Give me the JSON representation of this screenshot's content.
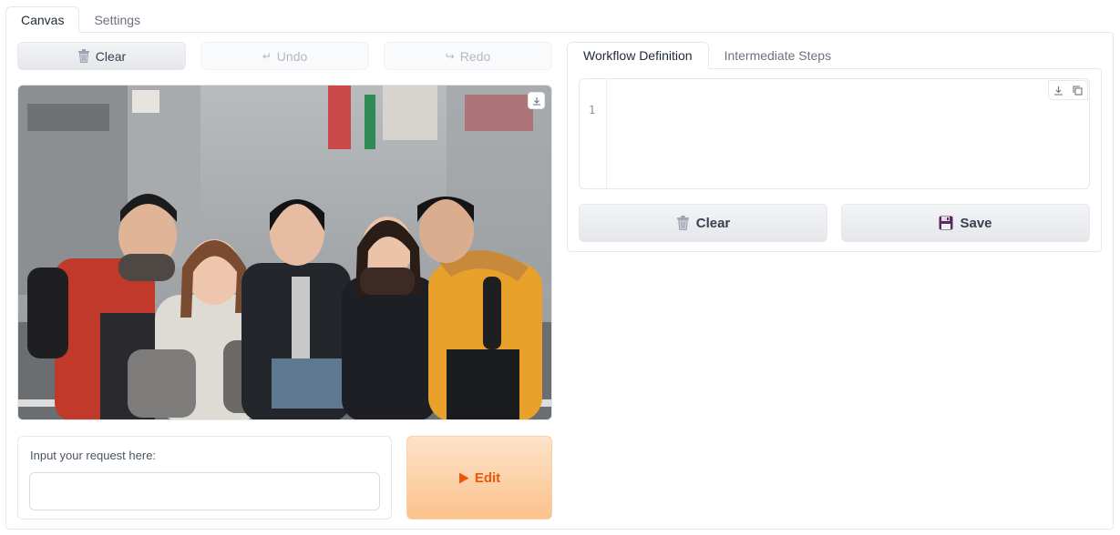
{
  "top_tabs": [
    {
      "label": "Canvas",
      "active": true
    },
    {
      "label": "Settings",
      "active": false
    }
  ],
  "toolbar": {
    "clear_label": "Clear",
    "undo_label": "Undo",
    "redo_label": "Redo"
  },
  "image": {
    "description_icon": "download-icon"
  },
  "request": {
    "label": "Input your request here:",
    "value": "",
    "placeholder": ""
  },
  "edit_button": {
    "label": "Edit",
    "icon": "play-icon",
    "color": "#ea580c"
  },
  "right_tabs": [
    {
      "label": "Workflow Definition",
      "active": true
    },
    {
      "label": "Intermediate Steps",
      "active": false
    }
  ],
  "code": {
    "line_number": "1",
    "content": ""
  },
  "actions": {
    "clear_label": "Clear",
    "save_label": "Save"
  }
}
